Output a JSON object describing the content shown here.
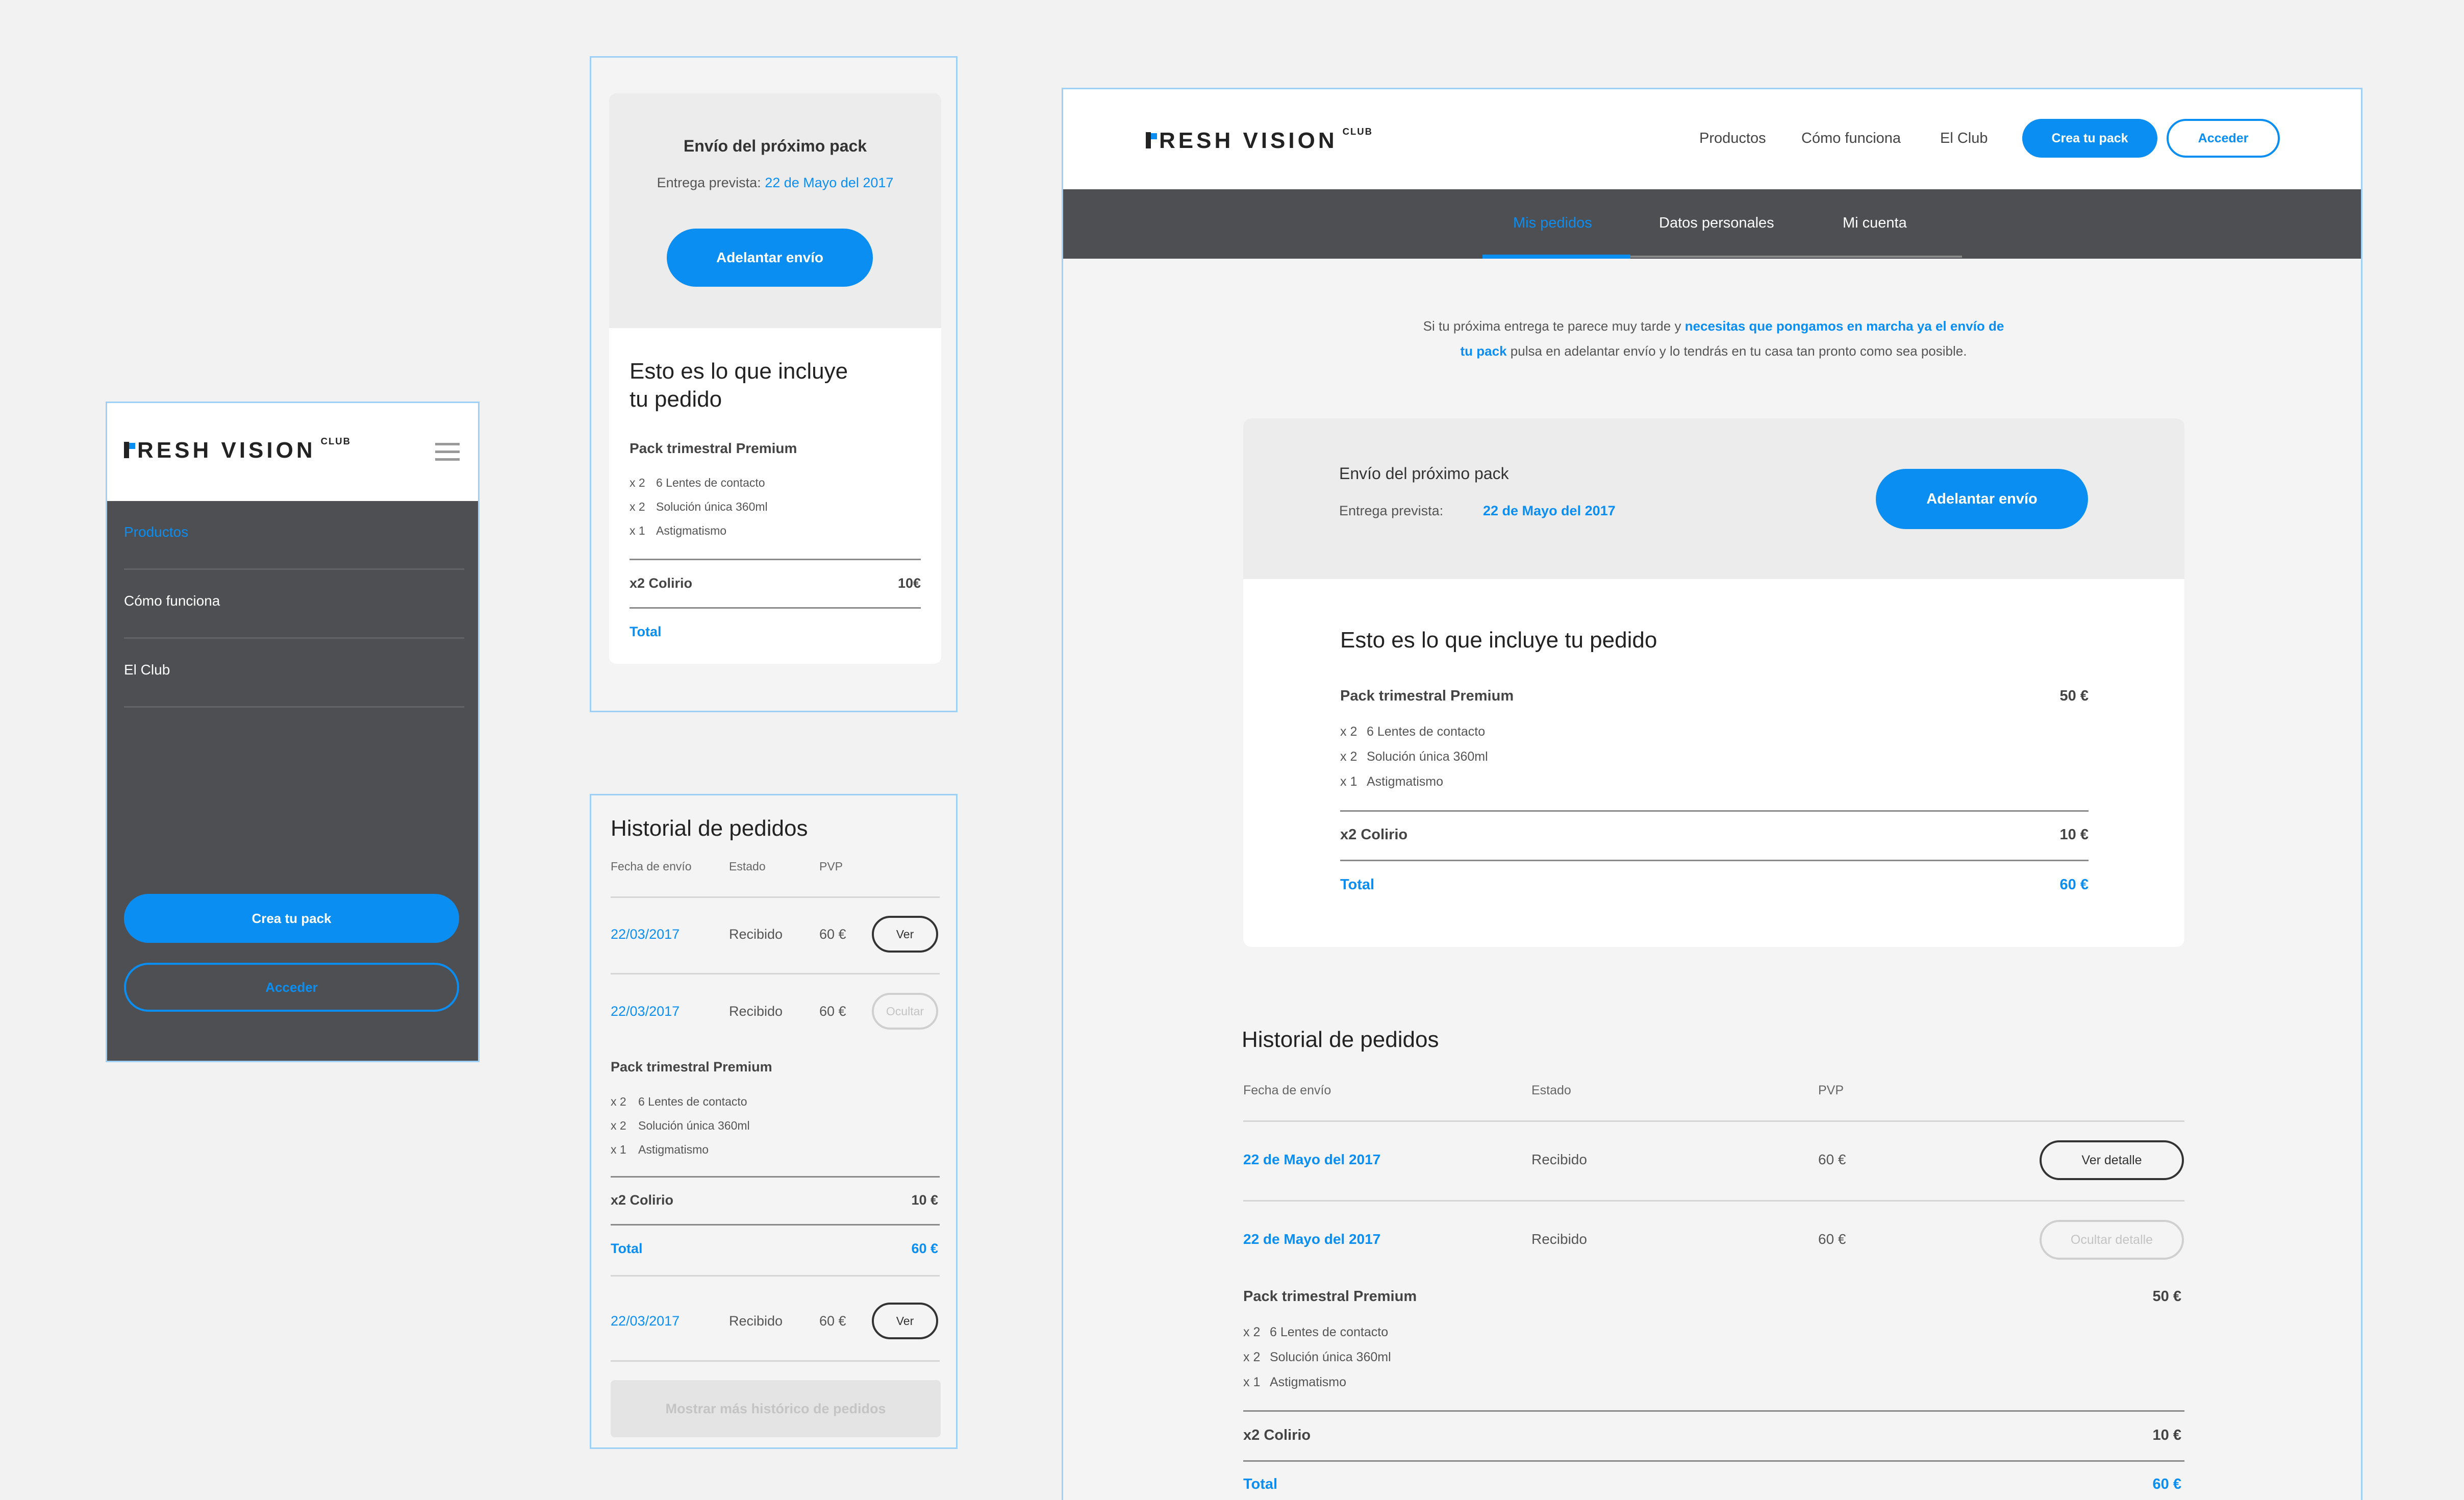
{
  "brand": {
    "logo_text": "RESH VISION",
    "logo_suffix": "CLUB"
  },
  "mobile_menu": {
    "items": [
      "Productos",
      "Cómo funciona",
      "El Club"
    ],
    "create_pack": "Crea tu pack",
    "login": "Acceder"
  },
  "next_pack": {
    "title": "Envío del próximo pack",
    "delivery_label": "Entrega prevista:",
    "delivery_date": "22 de Mayo del 2017",
    "advance_button": "Adelantar envío"
  },
  "order": {
    "heading": "Esto es lo que incluye tu pedido",
    "heading_line1": "Esto es lo que incluye",
    "heading_line2": "tu pedido",
    "pack_name": "Pack trimestral Premium",
    "pack_price": "50 €",
    "items": [
      {
        "qty": "x 2",
        "name": "6 Lentes de contacto"
      },
      {
        "qty": "x 2",
        "name": "Solución única 360ml"
      },
      {
        "qty": "x 1",
        "name": "Astigmatismo"
      }
    ],
    "extra_name": "x2 Colirio",
    "extra_price": "10 €",
    "extra_price_compact": "10€",
    "total_label": "Total",
    "total_price": "60 €"
  },
  "history": {
    "heading": "Historial de pedidos",
    "col_date": "Fecha de envío",
    "col_status": "Estado",
    "col_price": "PVP",
    "tablet_rows": [
      {
        "date": "22/03/2017",
        "status": "Recibido",
        "price": "60 €",
        "action": "Ver"
      },
      {
        "date": "22/03/2017",
        "status": "Recibido",
        "price": "60 €",
        "action": "Ocultar"
      },
      {
        "date": "22/03/2017",
        "status": "Recibido",
        "price": "60 €",
        "action": "Ver"
      }
    ],
    "desktop_rows": [
      {
        "date": "22 de Mayo del 2017",
        "status": "Recibido",
        "price": "60 €",
        "action": "Ver detalle"
      },
      {
        "date": "22 de Mayo del 2017",
        "status": "Recibido",
        "price": "60 €",
        "action": "Ocultar detalle"
      }
    ],
    "more_button": "Mostrar más histórico de pedidos"
  },
  "desktop": {
    "nav": [
      "Productos",
      "Cómo funciona",
      "El Club"
    ],
    "create_pack": "Crea tu pack",
    "login": "Acceder",
    "tabs": [
      "Mis pedidos",
      "Datos personales",
      "Mi cuenta"
    ],
    "intro_a": "Si tu próxima entrega te parece muy tarde y ",
    "intro_link_a": "necesitas que pongamos en marcha ya el envío de",
    "intro_link_b": "tu pack",
    "intro_b": " pulsa en adelantar envío y lo tendrás en tu casa tan pronto como sea posible."
  },
  "colors": {
    "accent": "#0a8ef2",
    "dark_bar": "#4e4f53",
    "background": "#f2f2f2"
  }
}
